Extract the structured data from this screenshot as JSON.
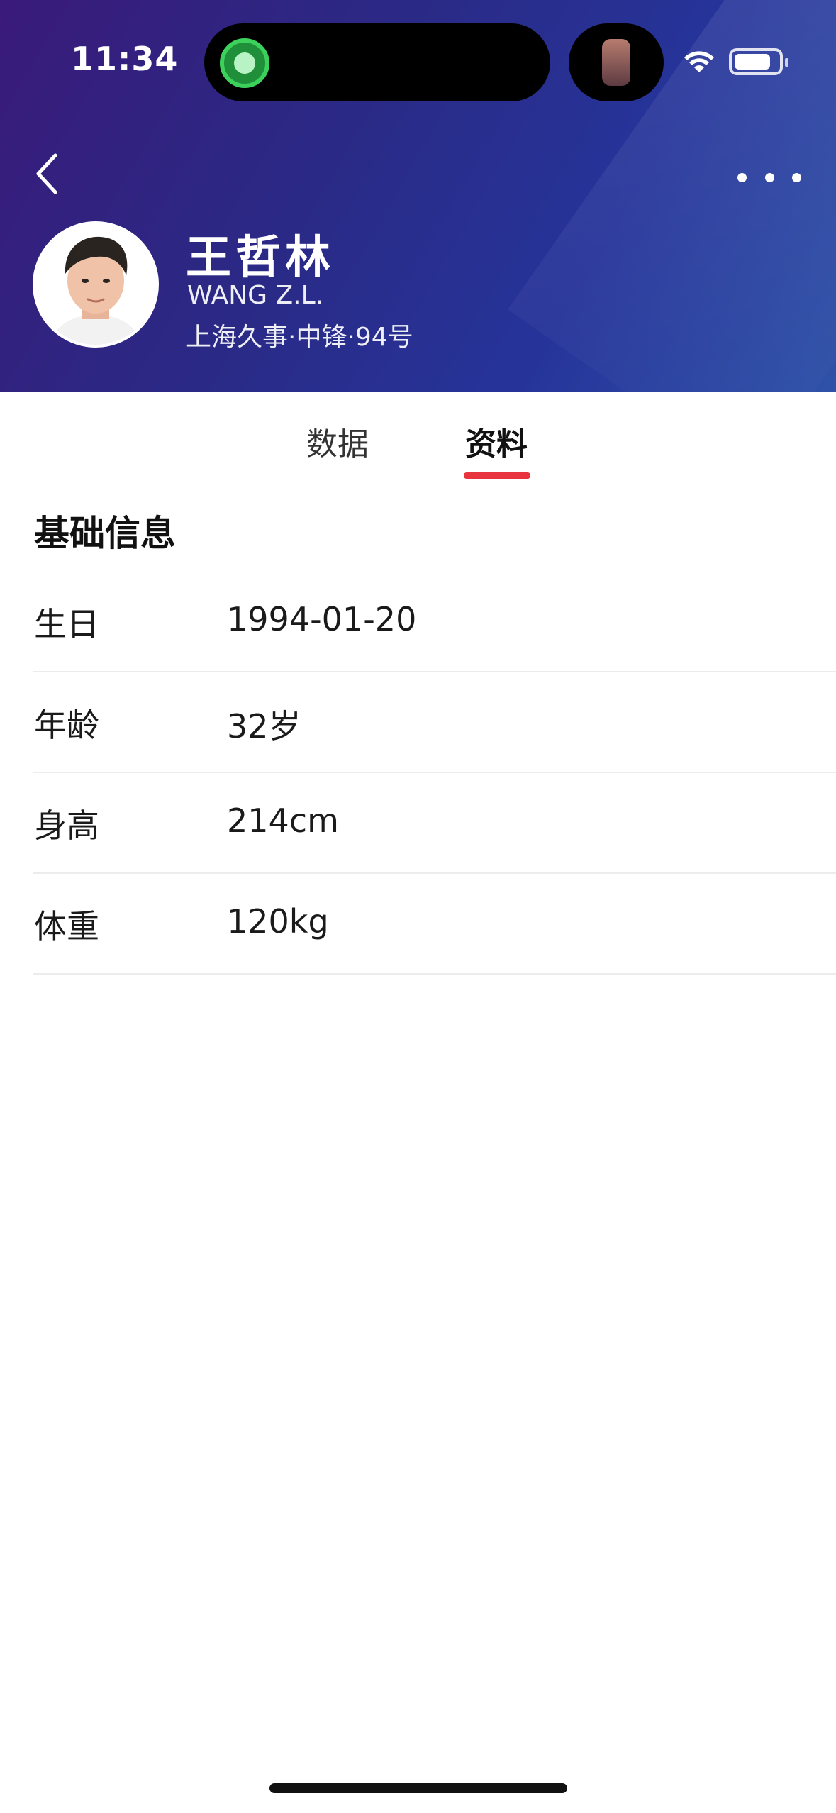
{
  "status_bar": {
    "time": "11:34"
  },
  "header": {
    "back_icon": "chevron-left-icon",
    "more_icon": "ellipsis-horizontal-icon",
    "player_name": "王哲林",
    "player_name_en": "WANG Z.L.",
    "player_team_position": "上海久事·中锋·94号",
    "gradient_colors": [
      "#3a1a7a",
      "#26349a",
      "#2f52a8"
    ]
  },
  "tabs": [
    {
      "label": "数据",
      "active": false
    },
    {
      "label": "资料",
      "active": true
    }
  ],
  "accent_color": "#e8343f",
  "section": {
    "title": "基础信息",
    "rows": [
      {
        "label": "生日",
        "value": "1994-01-20"
      },
      {
        "label": "年龄",
        "value": "32岁"
      },
      {
        "label": "身高",
        "value": "214cm"
      },
      {
        "label": "体重",
        "value": "120kg"
      }
    ]
  }
}
